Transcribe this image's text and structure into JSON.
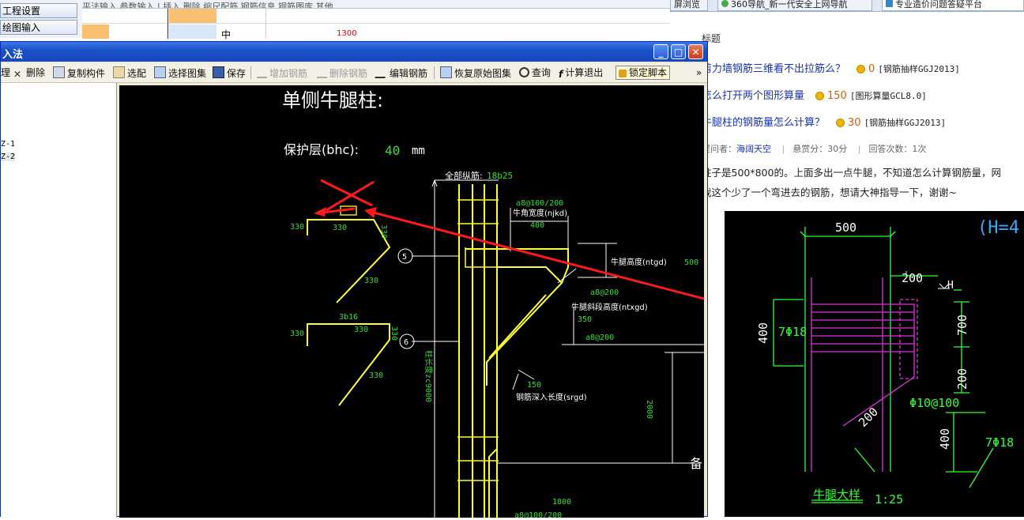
{
  "left_nav": {
    "item1": "工程设置",
    "item2": "绘图输入"
  },
  "bg_toolbar": {
    "text": "平法输入    参数输入    |    插入    删除    缩尺配筋    钢筋信息    钢筋图库    其他"
  },
  "bg_grid": {
    "marker": "中",
    "value": "1300"
  },
  "browser": {
    "tab1": "屏浏览",
    "tab2": "360导航_新一代安全上网导航",
    "tab3": "专业造价问题答疑平台",
    "section_label": "标题",
    "questions": [
      {
        "title": "剪力墙钢筋三维看不出拉筋么？",
        "count": "0",
        "category": "[钢筋抽样GGJ2013]"
      },
      {
        "title": "怎么打开两个图形算量",
        "count": "150",
        "category": "[图形算量GCL8.0]"
      },
      {
        "title": "牛腿柱的钢筋量怎么计算？",
        "count": "30",
        "category": "[钢筋抽样GGJ2013]"
      }
    ],
    "meta": {
      "asker_label": "提问者：",
      "asker": "海阔天空",
      "reward": "悬赏分：30分",
      "answers": "回答次数：1次"
    },
    "body_line1": "柱子是500*800的。上面多出一点牛腿，不知道怎么计算钢筋量，网",
    "body_line2": "我这个少了一个弯进去的钢筋，想请大神指导一下，谢谢~"
  },
  "dialog": {
    "title": "入法",
    "toolbar": {
      "manage": "理",
      "delete": "删除",
      "copy": "复制构件",
      "select": "选配",
      "choose_atlas": "选择图集",
      "save": "保存",
      "add_rebar": "增加钢筋",
      "del_rebar": "删除钢筋",
      "edit_rebar": "编辑钢筋",
      "restore": "恢复原始图集",
      "query": "查询",
      "calc_exit": "计算退出",
      "lock": "锁定脚本",
      "more": "»"
    },
    "tree": [
      "Z-1",
      "Z-2"
    ]
  },
  "cad": {
    "title": "单侧牛腿柱:",
    "cover_label": "保护层(bhc):",
    "cover_value": "40",
    "cover_unit": "mm",
    "all_long": "全部纵筋:",
    "all_long_val": "18b25",
    "a8_100": "a8@100/200",
    "corner_width": "牛角宽度(njkd)",
    "v400": "400",
    "corbel_height": "牛腿高度(ntgd)",
    "v500": "500",
    "a8_200a": "a8@200",
    "slope_height": "牛腿斜段高度(ntxgd)",
    "v350": "350",
    "a8_200b": "a8@200",
    "v150": "150",
    "anchor_len": "钢筋深入长度(srgd)",
    "v2000": "2000",
    "v1800": "1800",
    "a8_100b": "a8@100/200",
    "col_height": "柱长度zc9000",
    "note": "备",
    "s330a": "330",
    "s330b": "330",
    "s330c": "330",
    "s330d": "330",
    "s330e": "330",
    "s330f": "330",
    "s330g": "330",
    "s330h": "330",
    "b3b16": "3b16",
    "circle5": "5",
    "circle6": "6"
  },
  "ref_drawing": {
    "w500": "500",
    "h_label": "(H=4",
    "w200": "200",
    "h_mark": "H",
    "v400": "400",
    "bars7_18": "7Φ18",
    "v700": "700",
    "v200": "200",
    "stirrup": "Φ10@100",
    "d200": "200",
    "v400b": "400",
    "bars7_18b": "7Φ18",
    "caption": "牛腿大样",
    "scale": "1:25"
  },
  "colors": {
    "cad_bg": "#000000",
    "yellow": "#ffff33",
    "green": "#33dd33",
    "white": "#ffffff",
    "red": "#ff1a1a",
    "magenta": "#dd33dd"
  }
}
